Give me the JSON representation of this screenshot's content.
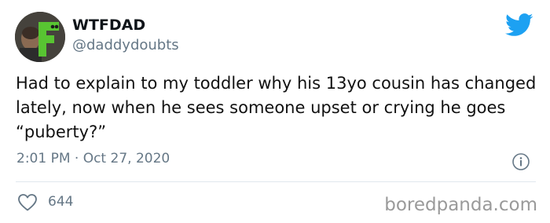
{
  "tweet": {
    "author": {
      "display_name": "WTFDAD",
      "handle": "@daddydoubts",
      "avatar_icon": "avatar-photo"
    },
    "text": "Had to explain to my toddler why his 13yo cousin has changed lately, now when he sees someone upset or crying he goes “puberty?”",
    "timestamp": "2:01 PM · Oct 27, 2020",
    "likes": "644"
  },
  "icons": {
    "brand": "twitter-bird-icon",
    "info": "info-icon",
    "like": "heart-icon"
  },
  "colors": {
    "twitter_blue": "#1da1f2",
    "secondary_text": "#657786",
    "avatar_green": "#58c432"
  },
  "watermark": "boredpanda.com"
}
